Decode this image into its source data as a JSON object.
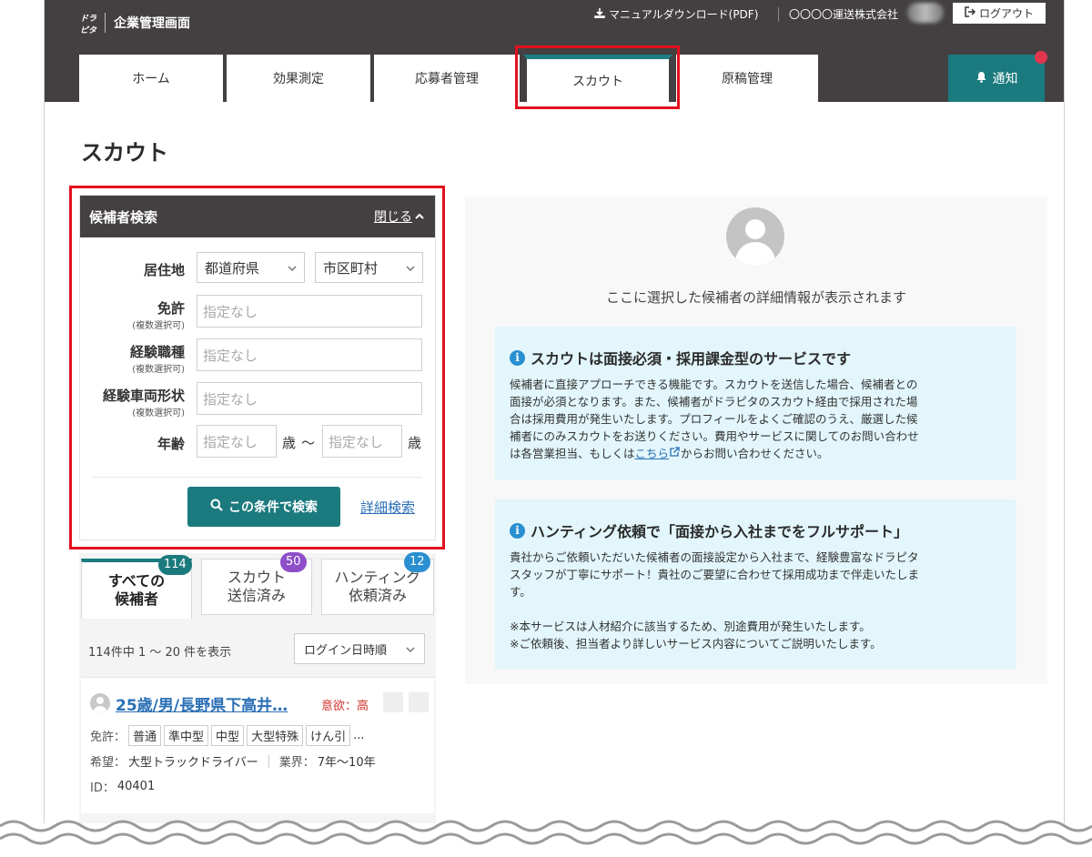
{
  "header": {
    "logo_text": "ドラピタ",
    "app_title": "企業管理画面",
    "manual_link": "マニュアルダウンロード(PDF)",
    "company": "〇〇〇〇運送株式会社",
    "logout": "ログアウト"
  },
  "tabs": [
    {
      "label": "ホーム"
    },
    {
      "label": "効果測定"
    },
    {
      "label": "応募者管理"
    },
    {
      "label": "スカウト"
    },
    {
      "label": "原稿管理"
    }
  ],
  "notify": {
    "label": "通知"
  },
  "page_title": "スカウト",
  "search_panel": {
    "title": "候補者検索",
    "close_label": "閉じる",
    "residence_label": "居住地",
    "prefecture_select": "都道府県",
    "city_select": "市区町村",
    "license_label": "免許",
    "license_sub": "(複数選択可)",
    "license_placeholder": "指定なし",
    "job_label": "経験職種",
    "job_sub": "(複数選択可)",
    "job_placeholder": "指定なし",
    "vehicle_label": "経験車両形状",
    "vehicle_sub": "(複数選択可)",
    "vehicle_placeholder": "指定なし",
    "age_label": "年齢",
    "age_min_placeholder": "指定なし",
    "age_unit": "歳",
    "age_tilde": "〜",
    "age_max_placeholder": "指定なし",
    "search_button": "この条件で検索",
    "detail_search": "詳細検索"
  },
  "list_tabs": [
    {
      "line1": "すべての",
      "line2": "候補者",
      "count": "114",
      "color": "#1b7a7e"
    },
    {
      "line1": "スカウト",
      "line2": "送信済み",
      "count": "50",
      "color": "#8e4fc9"
    },
    {
      "line1": "ハンティング",
      "line2": "依頼済み",
      "count": "12",
      "color": "#2a8fd0"
    }
  ],
  "list": {
    "count_text": "114件中 1 〜 20 件を表示",
    "sort_select": "ログイン日時順"
  },
  "candidate": {
    "title": "25歳/男/長野県下高井…",
    "motivation": "意欲：高",
    "license_label": "免許：",
    "licenses": [
      "普通",
      "準中型",
      "中型",
      "大型特殊",
      "けん引"
    ],
    "license_more": "...",
    "wish_label": "希望：",
    "wish_value": "大型トラックドライバー",
    "industry_label": "業界：",
    "industry_value": "7年〜10年",
    "id_label": "ID：",
    "id_value": "40401"
  },
  "detail": {
    "placeholder": "ここに選択した候補者の詳細情報が表示されます"
  },
  "info1": {
    "title": "スカウトは面接必須・採用課金型のサービスです",
    "lines": [
      "候補者に直接アプローチできる機能です。スカウトを送信した場合、候補者との",
      "面接が必須となります。また、候補者がドラピタのスカウト経由で採用された場",
      "合は採用費用が発生いたします。プロフィールをよくご確認のうえ、厳選した候",
      "補者にのみスカウトをお送りください。費用やサービスに関してのお問い合わせ"
    ],
    "last_prefix": "は各営業担当、もしくは",
    "link": "こちら",
    "last_suffix": "からお問い合わせください。"
  },
  "info2": {
    "title": "ハンティング依頼で「面接から入社までをフルサポート」",
    "lines": [
      "貴社からご依頼いただいた候補者の面接設定から入社まで、経験豊富なドラピタ",
      "スタッフが丁寧にサポート！貴社のご要望に合わせて採用成功まで伴走いたしま",
      "す。",
      "",
      "※本サービスは人材紹介に該当するため、別途費用が発生いたします。",
      "※ご依頼後、担当者より詳しいサービス内容についてご説明いたします。"
    ]
  },
  "colors": {
    "header_bg": "#444041",
    "accent": "#1b7a7e",
    "info_bg": "#e2f6fb",
    "highlight": "#e2101d",
    "link": "#2a6fb6"
  }
}
